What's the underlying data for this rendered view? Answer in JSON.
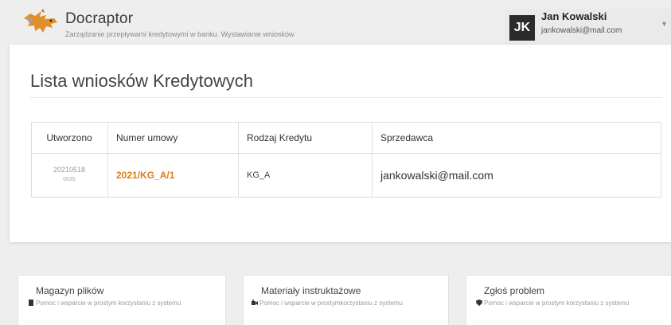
{
  "header": {
    "app_title": "Docraptor",
    "app_subtitle": "Zarządzanie przepływami kredytowymi w banku. Wystawianie wniosków",
    "user": {
      "initials": "JK",
      "name": "Jan Kowalski",
      "email": "jankowalski@mail.com",
      "caret": "▾"
    }
  },
  "main": {
    "title": "Lista wniosków Kredytowych",
    "table": {
      "headers": [
        "Utworzono",
        "Numer umowy",
        "Rodzaj Kredytu",
        "Sprzedawca"
      ],
      "rows": [
        {
          "created_date": "20210518",
          "created_time": "0035",
          "contract_number": "2021/KG_A/1",
          "credit_type": "KG_A",
          "seller": "jankowalski@mail.com"
        }
      ]
    }
  },
  "info_cards": [
    {
      "title": "Magazyn plików",
      "icon": "file-icon",
      "description": "Pomoc i wsparcie w prostym korzystaniu z systemu"
    },
    {
      "title": "Materiały instruktażowe",
      "icon": "video-icon",
      "description": "Pomoc i wsparcie w prostymkorzystaniu z systemu"
    },
    {
      "title": "Zgłoś problem",
      "icon": "shield-icon",
      "description": "Pomoc i wsparcie w prostym korzystaniu z systemu"
    }
  ],
  "colors": {
    "accent": "#e07a1a",
    "avatar_bg": "#2b2b2b"
  }
}
